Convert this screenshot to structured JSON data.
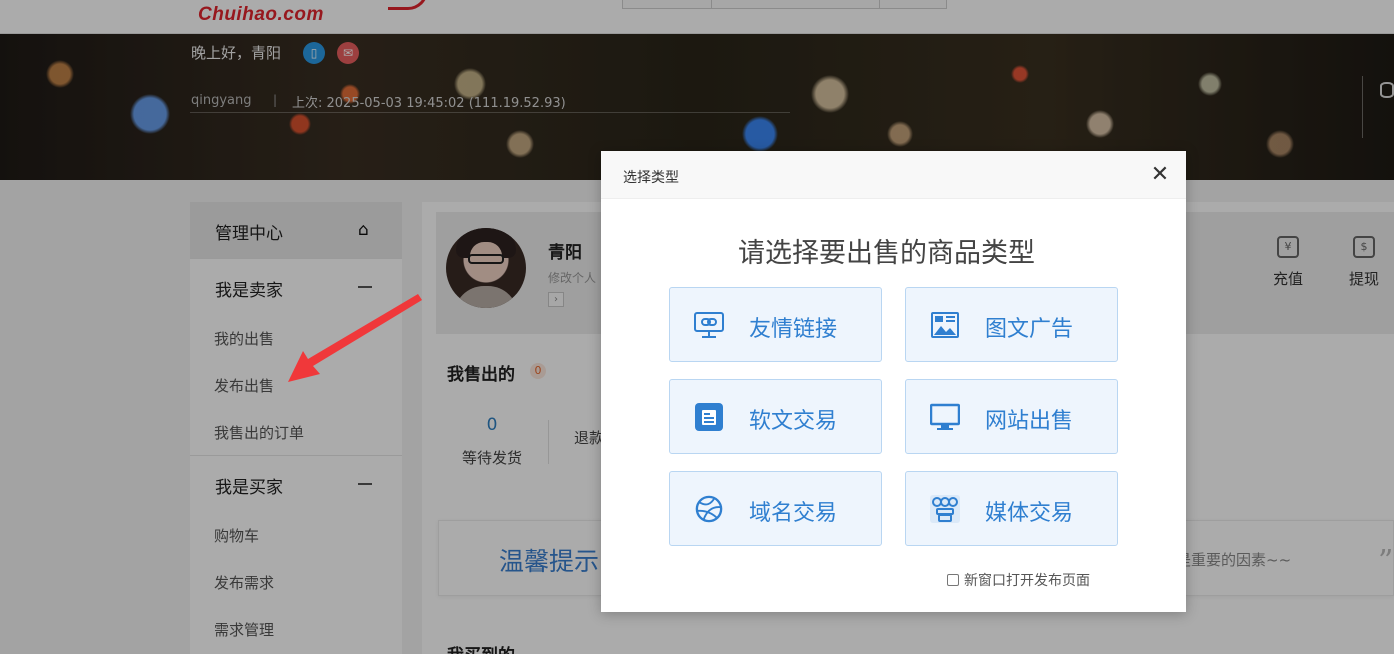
{
  "brand": {
    "logo_text": "Chuihao.com",
    "accent": "#e1252d"
  },
  "banner": {
    "greeting": "晚上好，青阳",
    "username": "qingyang",
    "separator": "|",
    "last_login": "上次: 2025-05-03 19:45:02 (111.19.52.93)"
  },
  "sidebar": {
    "header": "管理中心",
    "groups": [
      {
        "title": "我是卖家",
        "items": [
          "我的出售",
          "发布出售",
          "我售出的订单"
        ]
      },
      {
        "title": "我是买家",
        "items": [
          "购物车",
          "发布需求",
          "需求管理"
        ]
      }
    ]
  },
  "profile": {
    "name": "青阳",
    "edit_link": "修改个人",
    "arrow": "›",
    "quick_actions": [
      {
        "label": "充值",
        "icon": "recharge-icon"
      },
      {
        "label": "提现",
        "icon": "withdraw-icon"
      }
    ]
  },
  "sold": {
    "title": "我售出的",
    "badge": "0",
    "stats": [
      {
        "value": "0",
        "label": "等待发货"
      },
      {
        "value": "",
        "label": "退款"
      }
    ]
  },
  "tip": {
    "title": "温馨提示",
    "text": "是重要的因素~~",
    "quote": "”"
  },
  "bought": {
    "title": "我买到的"
  },
  "modal": {
    "title": "选择类型",
    "close": "✕",
    "heading": "请选择要出售的商品类型",
    "options": [
      {
        "label": "友情链接",
        "icon": "link-monitor-icon"
      },
      {
        "label": "图文广告",
        "icon": "image-ad-icon"
      },
      {
        "label": "软文交易",
        "icon": "article-icon"
      },
      {
        "label": "网站出售",
        "icon": "website-monitor-icon"
      },
      {
        "label": "域名交易",
        "icon": "domain-ball-icon"
      },
      {
        "label": "媒体交易",
        "icon": "media-icon"
      }
    ],
    "new_window_label": "新窗口打开发布页面",
    "new_window_checked": false,
    "accent": "#2f7fd0"
  },
  "annotation_color": "#f0383a"
}
